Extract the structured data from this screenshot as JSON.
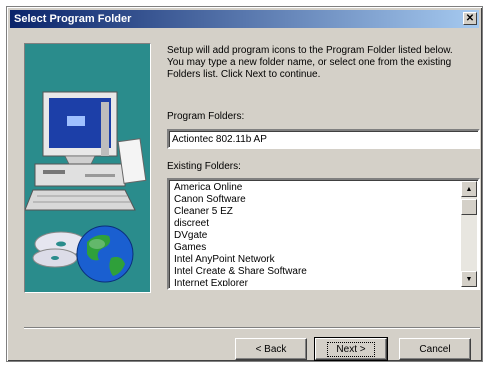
{
  "window": {
    "title": "Select Program Folder",
    "close_glyph": "✕"
  },
  "description": "Setup will add program icons to the Program Folder listed below.\nYou may type a new folder name, or select one from the existing\nFolders list.  Click Next to continue.",
  "program_folders": {
    "label": "Program Folders:",
    "value": "Actiontec 802.11b AP"
  },
  "existing_folders": {
    "label": "Existing Folders:",
    "items": [
      "America Online",
      "Canon Software",
      "Cleaner 5 EZ",
      "discreet",
      "DVgate",
      "Games",
      "Intel AnyPoint Network",
      "Intel Create & Share Software",
      "Internet Explorer"
    ],
    "scroll_up_glyph": "▲",
    "scroll_down_glyph": "▼"
  },
  "buttons": {
    "back": "< Back",
    "next": "Next >",
    "cancel": "Cancel"
  },
  "art": {
    "icons": [
      "computer-icon",
      "cd-icon",
      "globe-icon"
    ],
    "colors": {
      "background": "#2a8c8c",
      "monitor_screen": "#1c3fa8",
      "globe_ocean": "#1a5fd0",
      "globe_land": "#2fa03a"
    }
  },
  "colors": {
    "title_bar_start": "#0a246a",
    "title_bar_end": "#a6caf0",
    "dialog_face": "#d4d0c8"
  }
}
